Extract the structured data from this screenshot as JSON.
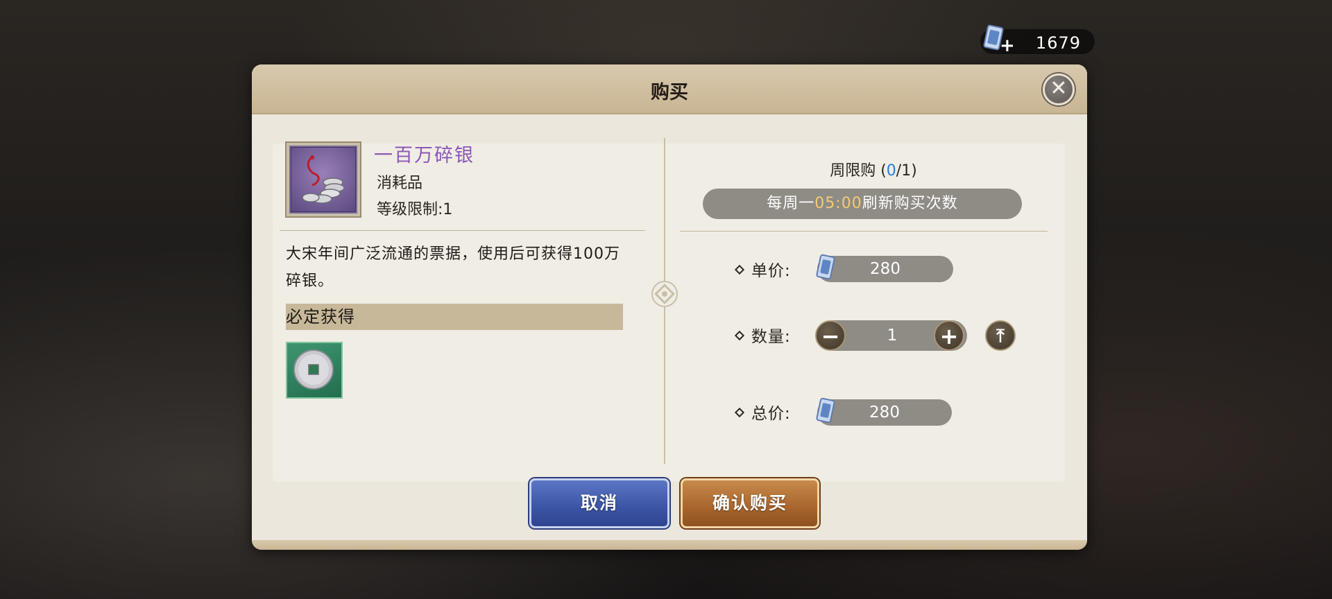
{
  "currency": {
    "icon": "ticket-icon",
    "value": "1679"
  },
  "dialog": {
    "title": "购买",
    "close_icon": "close-icon"
  },
  "item": {
    "name": "一百万碎银",
    "type": "消耗品",
    "level_limit": "等级限制:1",
    "description": "大宋年间广泛流通的票据，使用后可获得100万碎银。",
    "must_get_label": "必定获得",
    "reward_icon": "silver-coin-icon",
    "name_color": "#8b57b6"
  },
  "purchase": {
    "limit_label": "周限购 (",
    "limit_current": "0",
    "limit_sep": "/",
    "limit_max": "1",
    "limit_close": ")",
    "refresh_prefix": "每周一",
    "refresh_time": "05:00",
    "refresh_suffix": "刷新购买次数",
    "unit_price_label": "单价:",
    "unit_price": "280",
    "quantity_label": "数量:",
    "quantity": "1",
    "total_label": "总价:",
    "total_price": "280"
  },
  "buttons": {
    "cancel": "取消",
    "confirm": "确认购买"
  },
  "colors": {
    "accent_blue": "#2a7fd4",
    "refresh_time": "#f4cb76",
    "cancel_button": "#3b54a4",
    "confirm_button": "#a8652c"
  }
}
